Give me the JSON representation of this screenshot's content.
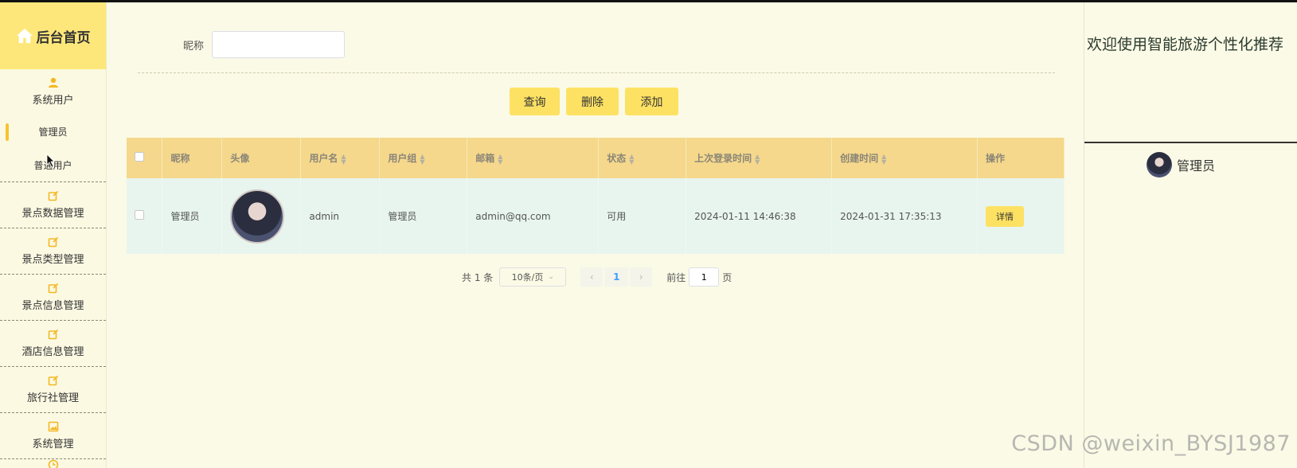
{
  "sidebar": {
    "brand": "后台首页",
    "groups": [
      {
        "label": "系统用户",
        "items": [
          "管理员",
          "普通用户"
        ]
      },
      {
        "label": "景点数据管理"
      },
      {
        "label": "景点类型管理"
      },
      {
        "label": "景点信息管理"
      },
      {
        "label": "酒店信息管理"
      },
      {
        "label": "旅行社管理"
      },
      {
        "label": "系统管理"
      }
    ]
  },
  "search": {
    "label": "昵称",
    "value": "",
    "placeholder": ""
  },
  "buttons": {
    "query": "查询",
    "delete": "删除",
    "add": "添加"
  },
  "table": {
    "headers": [
      "昵称",
      "头像",
      "用户名",
      "用户组",
      "邮箱",
      "状态",
      "上次登录时间",
      "创建时间",
      "操作"
    ],
    "rows": [
      {
        "nickname": "管理员",
        "username": "admin",
        "group": "管理员",
        "email": "admin@qq.com",
        "status": "可用",
        "last_login": "2024-01-11 14:46:38",
        "created": "2024-01-31 17:35:13",
        "action": "详情"
      }
    ]
  },
  "pager": {
    "total": "共 1 条",
    "page_size": "10条/页",
    "current": "1",
    "goto_label": "前往",
    "goto_value": "1",
    "page_unit": "页"
  },
  "right": {
    "welcome": "欢迎使用智能旅游个性化推荐",
    "username": "管理员"
  },
  "watermark": "CSDN @weixin_BYSJ1987",
  "colors": {
    "accent": "#fde163",
    "header": "#f5d88c",
    "row": "#e8f5ee",
    "background": "#fbfae6"
  }
}
